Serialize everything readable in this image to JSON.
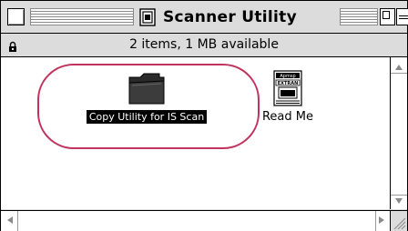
{
  "window": {
    "title": "Scanner Utility",
    "info_text": "2 items, 1 MB available"
  },
  "items": [
    {
      "label": "Copy Utility for IS Scan",
      "icon": "folder-icon",
      "selected": true
    },
    {
      "label": "Read Me",
      "icon": "document-icon",
      "selected": false
    }
  ],
  "readme_icon_text": {
    "line1": "Apmsp",
    "line2": "EXTRAN"
  },
  "colors": {
    "highlight_ring": "#c0335f",
    "chrome": "#dcdcdc",
    "selection": "#000000"
  }
}
